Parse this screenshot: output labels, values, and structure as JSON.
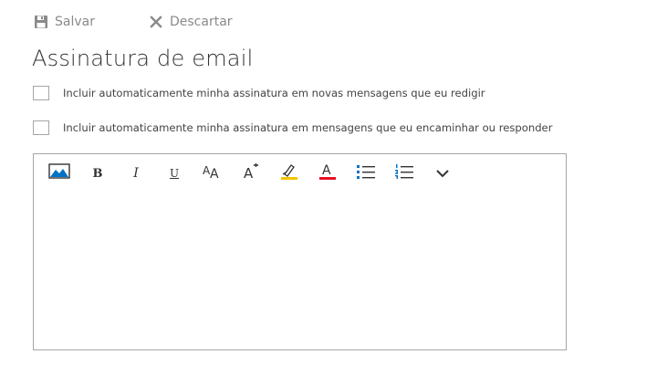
{
  "toolbar": {
    "save_label": "Salvar",
    "discard_label": "Descartar"
  },
  "page": {
    "title": "Assinatura de email"
  },
  "options": [
    {
      "label": "Incluir automaticamente minha assinatura em novas mensagens que eu redigir",
      "checked": false
    },
    {
      "label": "Incluir automaticamente minha assinatura em mensagens que eu encaminhar ou responder",
      "checked": false
    }
  ],
  "editor": {
    "buttons": [
      {
        "icon": "insert-image-icon"
      },
      {
        "icon": "bold-icon",
        "glyph": "B"
      },
      {
        "icon": "italic-icon",
        "glyph": "I"
      },
      {
        "icon": "underline-icon",
        "glyph": "U"
      },
      {
        "icon": "font-size-icon"
      },
      {
        "icon": "grow-font-icon"
      },
      {
        "icon": "highlight-icon"
      },
      {
        "icon": "font-color-icon"
      },
      {
        "icon": "bulleted-list-icon"
      },
      {
        "icon": "numbered-list-icon"
      },
      {
        "icon": "more-options-icon"
      }
    ],
    "content": ""
  },
  "colors": {
    "accent_blue": "#0072c6",
    "highlight_yellow": "#f5c400",
    "font_color_red": "#e81123",
    "muted_text": "#8a8a8a",
    "border": "#a6a6a6"
  }
}
